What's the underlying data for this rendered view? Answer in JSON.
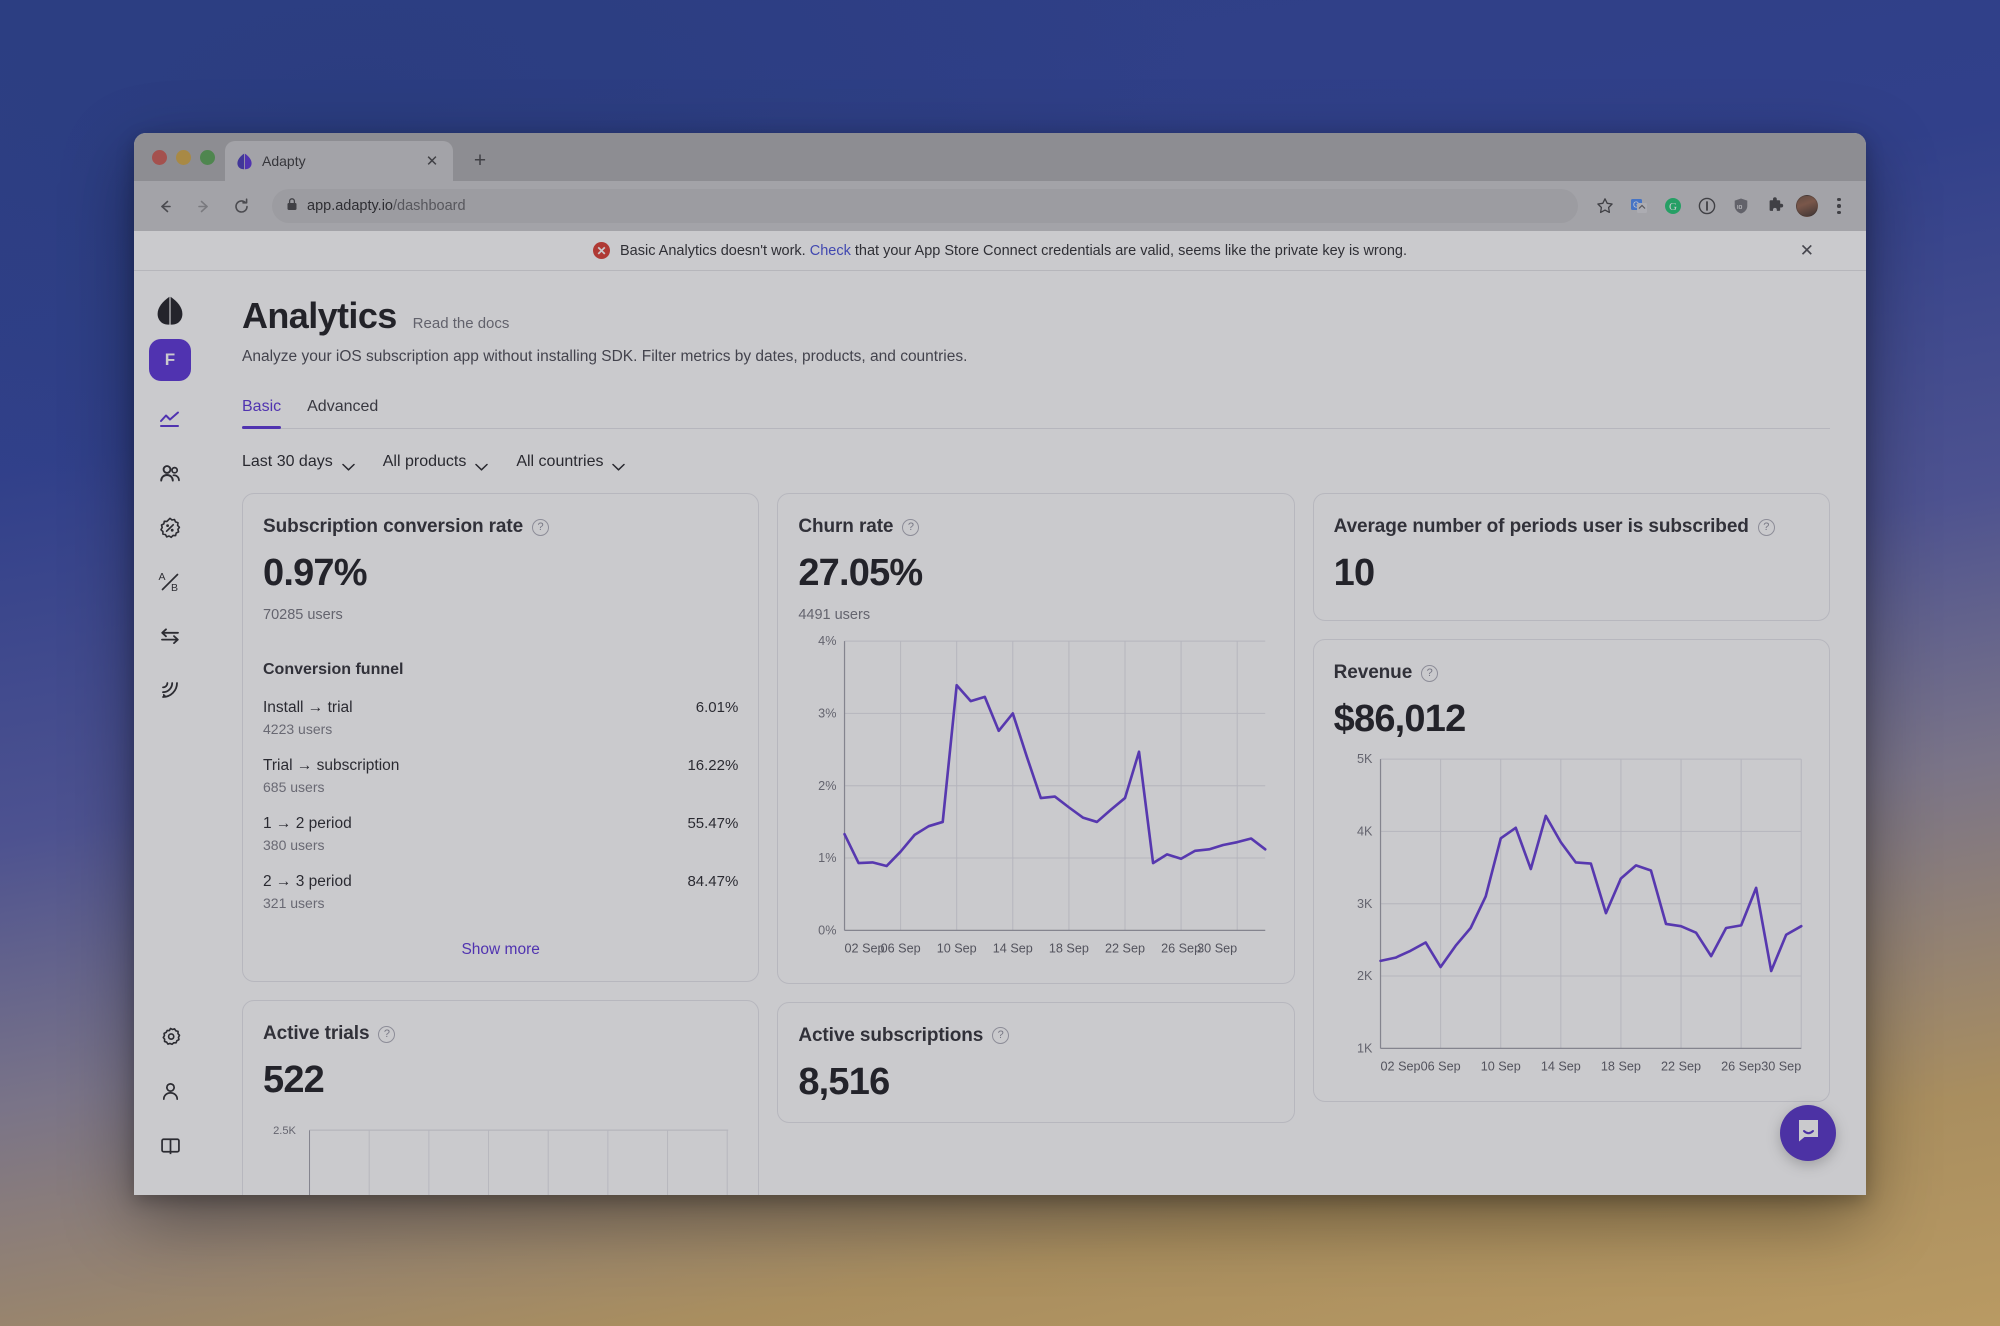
{
  "browser": {
    "tab": {
      "title": "Adapty",
      "favicon": "adapty-logo-icon",
      "close_label": "✕"
    },
    "new_tab_label": "+",
    "nav": {
      "back": "←",
      "forward": "→",
      "reload": "⟳"
    },
    "omnibox": {
      "lock": "lock-icon",
      "host": "app.adapty.io",
      "path": "/dashboard"
    },
    "toolbar_icons": [
      "star-icon",
      "translate-icon",
      "grammarly-icon",
      "info-icon",
      "shield-icon",
      "extensions-icon",
      "profile-avatar",
      "kebab-menu-icon"
    ]
  },
  "notification": {
    "icon": "error-icon",
    "text_before": "Basic Analytics doesn't work.",
    "link": "Check",
    "text_after": "that your App Store Connect credentials are valid, seems like the private key is wrong.",
    "close": "✕"
  },
  "sidebar": {
    "logo": "adapty-logo-icon",
    "app_badge": "F",
    "items": [
      {
        "name": "analytics",
        "icon": "line-chart-icon",
        "active": true
      },
      {
        "name": "users",
        "icon": "users-icon",
        "active": false
      },
      {
        "name": "promo",
        "icon": "badge-percent-icon",
        "active": false
      },
      {
        "name": "ab-tests",
        "icon": "ab-test-icon",
        "active": false
      },
      {
        "name": "integrations",
        "icon": "arrows-exchange-icon",
        "active": false
      },
      {
        "name": "events",
        "icon": "broadcast-icon",
        "active": false
      }
    ],
    "bottom_items": [
      {
        "name": "settings",
        "icon": "gear-icon"
      },
      {
        "name": "account",
        "icon": "user-icon"
      },
      {
        "name": "docs",
        "icon": "book-icon"
      }
    ]
  },
  "header": {
    "title": "Analytics",
    "docs_link": "Read the docs",
    "subtitle": "Analyze your iOS subscription app without installing SDK. Filter metrics by dates, products, and countries."
  },
  "tabs": [
    {
      "label": "Basic",
      "active": true
    },
    {
      "label": "Advanced",
      "active": false
    }
  ],
  "filters": [
    {
      "label": "Last 30 days"
    },
    {
      "label": "All products"
    },
    {
      "label": "All countries"
    }
  ],
  "cards": {
    "conversion": {
      "title": "Subscription conversion rate",
      "value": "0.97%",
      "users": "70285 users",
      "funnel_title": "Conversion funnel",
      "funnel": [
        {
          "label": "Install → trial",
          "pct": "6.01%",
          "users": "4223 users"
        },
        {
          "label": "Trial → subscription",
          "pct": "16.22%",
          "users": "685 users"
        },
        {
          "label": "1 → 2 period",
          "pct": "55.47%",
          "users": "380 users"
        },
        {
          "label": "2 → 3 period",
          "pct": "84.47%",
          "users": "321 users"
        }
      ],
      "show_more": "Show more"
    },
    "churn": {
      "title": "Churn rate",
      "value": "27.05%",
      "users": "4491 users"
    },
    "avg_periods": {
      "title": "Average number of periods user is subscribed",
      "value": "10"
    },
    "revenue": {
      "title": "Revenue",
      "value": "$86,012"
    },
    "active_trials": {
      "title": "Active trials",
      "value": "522"
    },
    "active_subscriptions": {
      "title": "Active subscriptions",
      "value": "8,516"
    }
  },
  "colors": {
    "accent": "#5127d6",
    "chart_line": "#5b2fd4",
    "error": "#d93025",
    "link": "#3b45d6"
  },
  "chart_data": [
    {
      "id": "churn-rate-chart",
      "type": "line",
      "title": "Churn rate",
      "ylabel": "",
      "xlabel": "",
      "ylim": [
        0,
        4
      ],
      "ytick_labels": [
        "0%",
        "1%",
        "2%",
        "3%",
        "4%"
      ],
      "yticks": [
        0,
        1,
        2,
        3,
        4
      ],
      "xtick_labels": [
        "02 Sep",
        "06 Sep",
        "10 Sep",
        "14 Sep",
        "18 Sep",
        "22 Sep",
        "26 Sep",
        "30 Sep"
      ],
      "grid": true,
      "x": [
        "02 Sep",
        "03 Sep",
        "04 Sep",
        "05 Sep",
        "06 Sep",
        "07 Sep",
        "08 Sep",
        "09 Sep",
        "10 Sep",
        "11 Sep",
        "12 Sep",
        "13 Sep",
        "14 Sep",
        "15 Sep",
        "16 Sep",
        "17 Sep",
        "18 Sep",
        "19 Sep",
        "20 Sep",
        "21 Sep",
        "22 Sep",
        "23 Sep",
        "24 Sep",
        "25 Sep",
        "26 Sep",
        "27 Sep",
        "28 Sep",
        "29 Sep",
        "30 Sep"
      ],
      "values": [
        1.33,
        0.93,
        0.94,
        0.89,
        1.09,
        1.32,
        1.44,
        1.5,
        3.39,
        3.17,
        3.23,
        2.76,
        3.0,
        2.4,
        1.83,
        1.85,
        1.7,
        1.56,
        1.5,
        1.67,
        1.83,
        2.47,
        0.93,
        1.05,
        0.99,
        1.1,
        1.12,
        1.18,
        1.22,
        1.27,
        1.12
      ]
    },
    {
      "id": "revenue-chart",
      "type": "line",
      "title": "Revenue",
      "ylabel": "",
      "xlabel": "",
      "ylim": [
        1000,
        5000
      ],
      "ytick_labels": [
        "1K",
        "2K",
        "3K",
        "4K",
        "5K"
      ],
      "yticks": [
        1000,
        2000,
        3000,
        4000,
        5000
      ],
      "xtick_labels": [
        "02 Sep",
        "06 Sep",
        "10 Sep",
        "14 Sep",
        "18 Sep",
        "22 Sep",
        "26 Sep",
        "30 Sep"
      ],
      "grid": true,
      "x": [
        "02 Sep",
        "03 Sep",
        "04 Sep",
        "05 Sep",
        "06 Sep",
        "07 Sep",
        "08 Sep",
        "09 Sep",
        "10 Sep",
        "11 Sep",
        "12 Sep",
        "13 Sep",
        "14 Sep",
        "15 Sep",
        "16 Sep",
        "17 Sep",
        "18 Sep",
        "19 Sep",
        "20 Sep",
        "21 Sep",
        "22 Sep",
        "23 Sep",
        "24 Sep",
        "25 Sep",
        "26 Sep",
        "27 Sep",
        "28 Sep",
        "29 Sep",
        "30 Sep"
      ],
      "values": [
        2210,
        2255,
        2350,
        2465,
        2125,
        2420,
        2665,
        3100,
        3905,
        4050,
        3480,
        4215,
        3850,
        3570,
        3555,
        2870,
        3350,
        3530,
        3460,
        2720,
        2690,
        2600,
        2275,
        2665,
        2700,
        3220,
        2070,
        2570,
        2690
      ]
    },
    {
      "id": "active-trials-chart",
      "type": "line",
      "title": "Active trials",
      "ylim": [
        0,
        2500
      ],
      "ytick_labels": [
        "2.5K"
      ],
      "grid": true,
      "partial_view": true
    },
    {
      "id": "active-subscriptions-chart",
      "type": "line",
      "title": "Active subscriptions",
      "partial_view": true
    }
  ]
}
